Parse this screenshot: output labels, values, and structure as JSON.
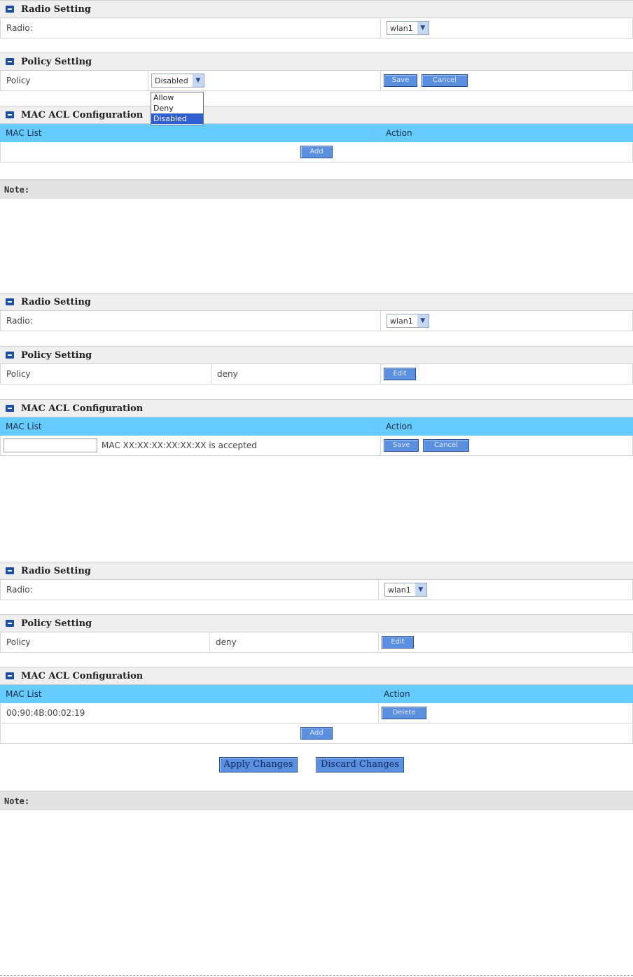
{
  "radio_setting": {
    "title": "Radio Setting",
    "label": "Radio:",
    "value": "wlan1"
  },
  "policy_setting": {
    "title": "Policy Setting",
    "label": "Policy"
  },
  "mac_acl": {
    "title": "MAC ACL Configuration",
    "col_mac": "MAC List",
    "col_action": "Action"
  },
  "screen1": {
    "policy_select_value": "Disabled",
    "dropdown_options": [
      "Allow",
      "Deny",
      "Disabled"
    ],
    "save_label": "Save",
    "cancel_label": "Cancel",
    "add_label": "Add",
    "note_label": "Note:"
  },
  "screen2": {
    "policy_value": "deny",
    "edit_label": "Edit",
    "mac_input_value": "",
    "mac_hint": "MAC XX:XX:XX:XX:XX:XX is accepted",
    "save_label": "Save",
    "cancel_label": "Cancel"
  },
  "screen3": {
    "policy_value": "deny",
    "edit_label": "Edit",
    "mac_entry": "00:90:4B:00:02:19",
    "delete_label": "Delete",
    "add_label": "Add",
    "apply_label": "Apply Changes",
    "discard_label": "Discard Changes",
    "note_label": "Note:"
  },
  "colors": {
    "header_blue": "#66ccff",
    "button_blue": "#5b8fe0",
    "icon_blue": "#1c4fa0"
  }
}
